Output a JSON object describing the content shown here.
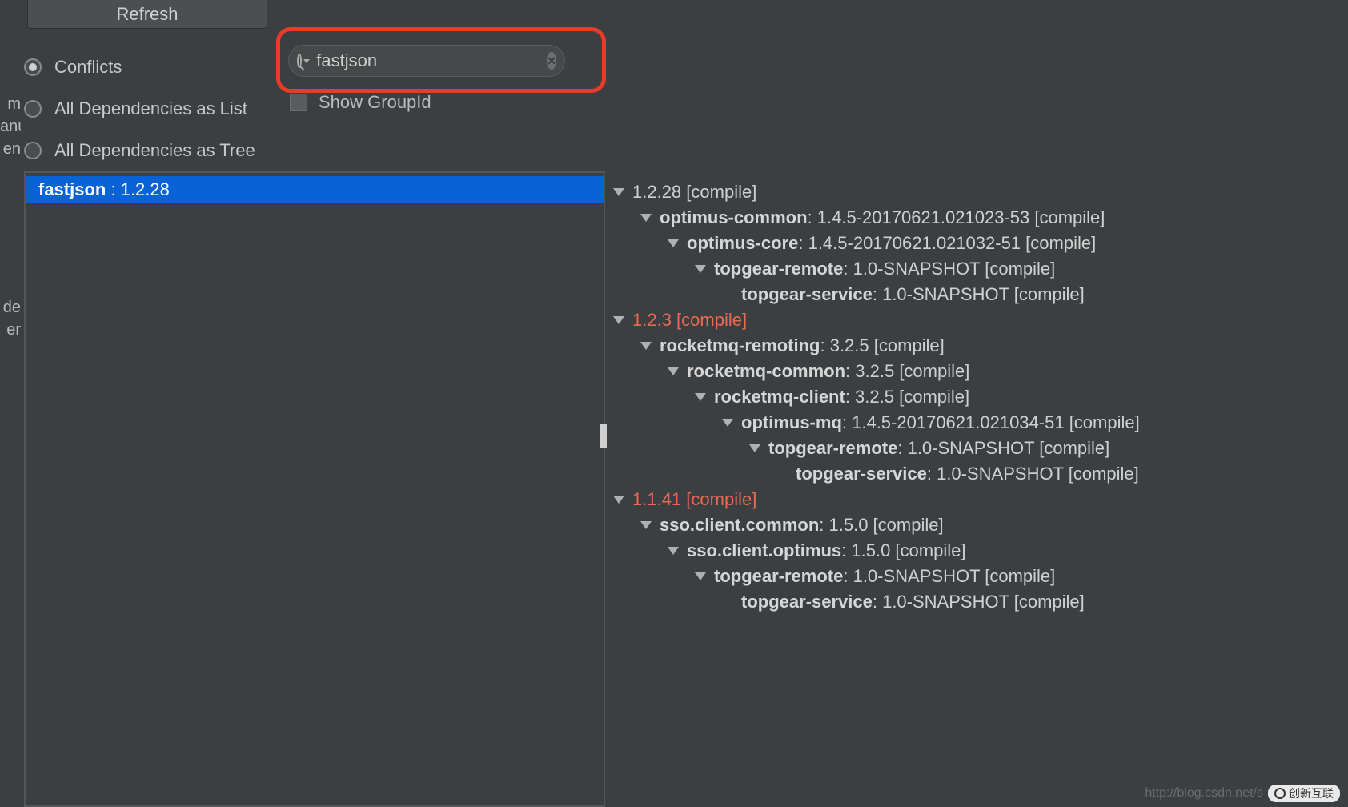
{
  "toolbar": {
    "refresh_label": "Refresh",
    "radios": [
      {
        "label": "Conflicts",
        "selected": true
      },
      {
        "label": "All Dependencies as List",
        "selected": false
      },
      {
        "label": "All Dependencies as Tree",
        "selected": false
      }
    ],
    "search_value": "fastjson",
    "show_groupid_label": "Show GroupId"
  },
  "left_edge_fragments": [
    "m",
    "anu",
    "en",
    "de",
    "er"
  ],
  "left_panel": {
    "selected": {
      "name": "fastjson",
      "sep": " : ",
      "version": "1.2.28"
    }
  },
  "tree": [
    {
      "indent": 1,
      "expanded": true,
      "root": true,
      "conflict": false,
      "label": "1.2.28 [compile]"
    },
    {
      "indent": 2,
      "expanded": true,
      "artifact": "optimus-common",
      "meta": " : 1.4.5-20170621.021023-53 [compile]"
    },
    {
      "indent": 3,
      "expanded": true,
      "artifact": "optimus-core",
      "meta": " : 1.4.5-20170621.021032-51 [compile]"
    },
    {
      "indent": 4,
      "expanded": true,
      "artifact": "topgear-remote",
      "meta": " : 1.0-SNAPSHOT [compile]"
    },
    {
      "indent": 5,
      "expanded": false,
      "leaf": true,
      "artifact": "topgear-service",
      "meta": " : 1.0-SNAPSHOT [compile]"
    },
    {
      "indent": 1,
      "expanded": true,
      "root": true,
      "conflict": true,
      "label": "1.2.3 [compile]"
    },
    {
      "indent": 2,
      "expanded": true,
      "artifact": "rocketmq-remoting",
      "meta": " : 3.2.5 [compile]"
    },
    {
      "indent": 3,
      "expanded": true,
      "artifact": "rocketmq-common",
      "meta": " : 3.2.5 [compile]"
    },
    {
      "indent": 4,
      "expanded": true,
      "artifact": "rocketmq-client",
      "meta": " : 3.2.5 [compile]"
    },
    {
      "indent": 5,
      "expanded": true,
      "artifact": "optimus-mq",
      "meta": " : 1.4.5-20170621.021034-51 [compile]"
    },
    {
      "indent": 6,
      "expanded": true,
      "artifact": "topgear-remote",
      "meta": " : 1.0-SNAPSHOT [compile]"
    },
    {
      "indent": 7,
      "expanded": false,
      "leaf": true,
      "artifact": "topgear-service",
      "meta": " : 1.0-SNAPSHOT [compile]"
    },
    {
      "indent": 1,
      "expanded": true,
      "root": true,
      "conflict": true,
      "label": "1.1.41 [compile]"
    },
    {
      "indent": 2,
      "expanded": true,
      "artifact": "sso.client.common",
      "meta": " : 1.5.0 [compile]"
    },
    {
      "indent": 3,
      "expanded": true,
      "artifact": "sso.client.optimus",
      "meta": " : 1.5.0 [compile]"
    },
    {
      "indent": 4,
      "expanded": true,
      "artifact": "topgear-remote",
      "meta": " : 1.0-SNAPSHOT [compile]"
    },
    {
      "indent": 5,
      "expanded": false,
      "leaf": true,
      "artifact": "topgear-service",
      "meta": " : 1.0-SNAPSHOT [compile]"
    }
  ],
  "watermark": {
    "url": "http://blog.csdn.net/s",
    "badge": "创新互联"
  }
}
